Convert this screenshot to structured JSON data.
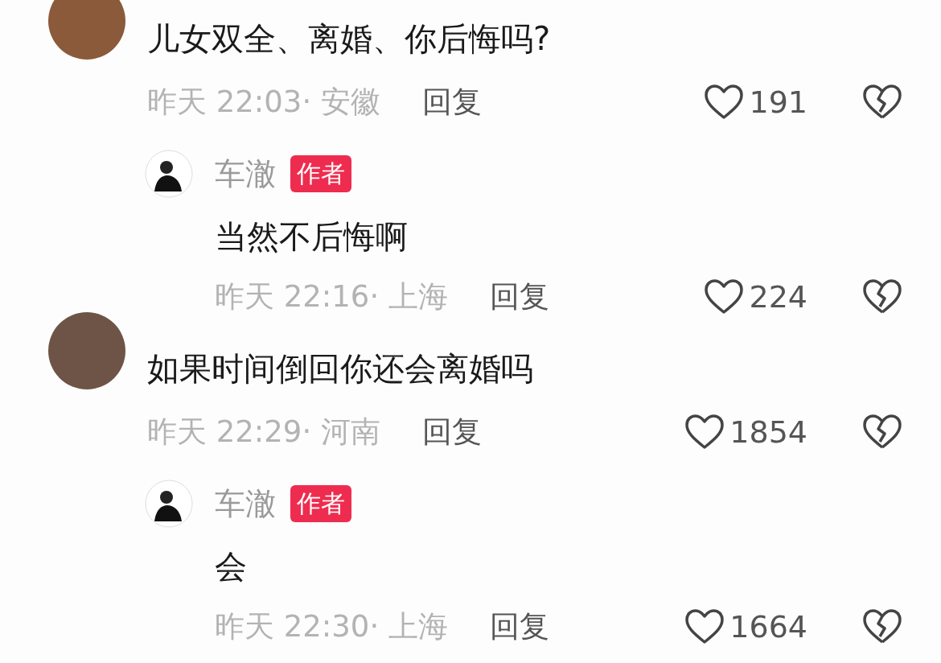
{
  "comments": [
    {
      "text": "儿女双全、离婚、你后悔吗?",
      "meta": "昨天 22:03· 安徽",
      "reply_label": "回复",
      "likes": "191",
      "replies": [
        {
          "name": "车澈",
          "badge": "作者",
          "text": "当然不后悔啊",
          "meta": "昨天 22:16· 上海",
          "reply_label": "回复",
          "likes": "224"
        }
      ]
    },
    {
      "text": "如果时间倒回你还会离婚吗",
      "meta": "昨天 22:29· 河南",
      "reply_label": "回复",
      "likes": "1854",
      "replies": [
        {
          "name": "车澈",
          "badge": "作者",
          "text": "会",
          "meta": "昨天 22:30· 上海",
          "reply_label": "回复",
          "likes": "1664"
        }
      ]
    }
  ]
}
